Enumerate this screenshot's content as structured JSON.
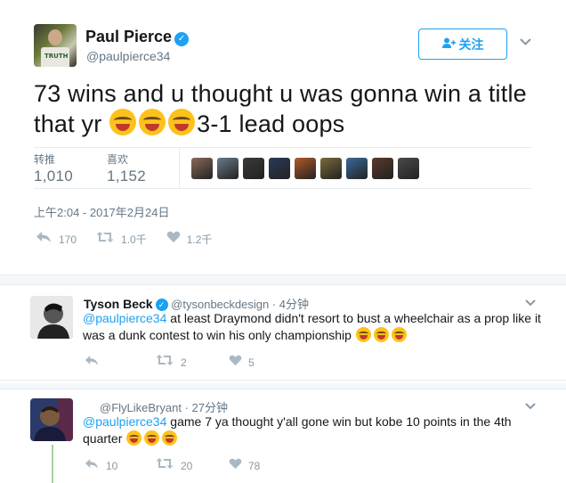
{
  "main_tweet": {
    "author_name": "Paul Pierce",
    "handle": "@paulpierce34",
    "avatar_text": "TRUTH",
    "follow_label": "关注",
    "text_part1": "73 wins and u thought u was gonna win a title that yr ",
    "text_part2": "3-1 lead oops",
    "retweets_label": "转推",
    "retweets_value": "1,010",
    "likes_label": "喜欢",
    "likes_value": "1,152",
    "timestamp": "上午2:04 - 2017年2月24日",
    "reply_count": "170",
    "retweet_count": "1.0千",
    "like_count": "1.2千",
    "liker_colors": [
      "#8a6a5a",
      "#6a7a8a",
      "#3a3a3a",
      "#2a3a5a",
      "#b05a2a",
      "#7a6a3a",
      "#3a6a9a",
      "#5a3a2a",
      "#4a4a4a"
    ]
  },
  "replies": [
    {
      "author_name": "Tyson Beck",
      "handle": "@tysonbeckdesign",
      "time": "· 4分钟",
      "mention": "@paulpierce34",
      "text": " at least Draymond didn't resort to bust a wheelchair as a prop like it was a dunk contest to win his only championship ",
      "reply_count": "",
      "retweet_count": "2",
      "like_count": "5"
    },
    {
      "author_name": "",
      "handle": "@FlyLikeBryant",
      "time": "· 27分钟",
      "mention": "@paulpierce34",
      "text": " game 7 ya thought y'all gone win but kobe 10 points in the 4th quarter ",
      "reply_count": "10",
      "retweet_count": "20",
      "like_count": "78"
    }
  ],
  "colors": {
    "accent": "#1da1f2",
    "mention": "#1da1f2",
    "muted": "#657786",
    "thread": "#a3d39c"
  },
  "icons": {
    "verified": "verified-check-icon",
    "follow": "add-user-icon",
    "caret": "chevron-down-icon",
    "reply": "reply-arrow-icon",
    "retweet": "retweet-icon",
    "like": "heart-icon",
    "emoji": "face-with-tears-of-joy-emoji"
  }
}
